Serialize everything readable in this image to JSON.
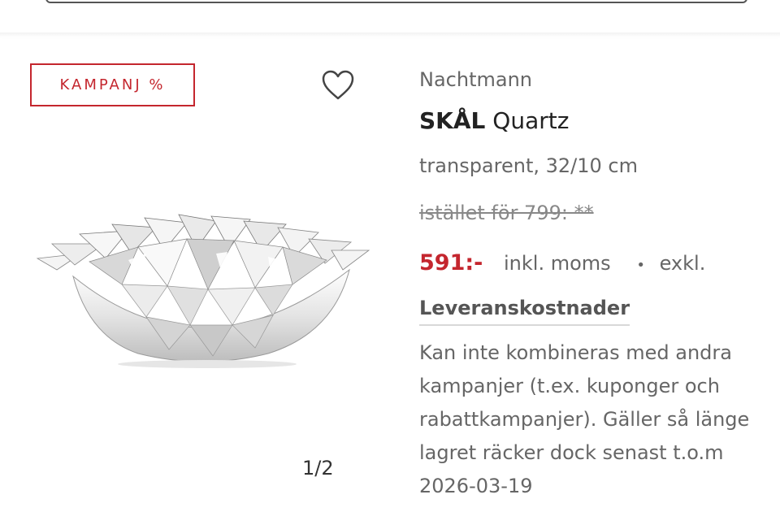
{
  "badge": {
    "label": "KAMPANJ %"
  },
  "icons": {
    "favorite": "heart-outline-icon"
  },
  "gallery": {
    "pager": "1/2"
  },
  "product": {
    "brand": "Nachtmann",
    "type": "SKÅL",
    "name": "Quartz",
    "variant": "transparent, 32/10 cm"
  },
  "pricing": {
    "old_price": "istället för 799:  **",
    "price": "591:-",
    "vat_included_label": "inkl. moms",
    "separator": "•",
    "vat_excluded_label": "exkl."
  },
  "delivery": {
    "label": "Leveranskostnader"
  },
  "terms": "Kan inte kombineras med andra kampanjer (t.ex. kuponger och rabattkampanjer). Gäller så länge lagret räcker dock senast t.o.m 2026-03-19",
  "colors": {
    "accent": "#c4262e",
    "text_primary": "#222222",
    "text_secondary": "#666666"
  }
}
